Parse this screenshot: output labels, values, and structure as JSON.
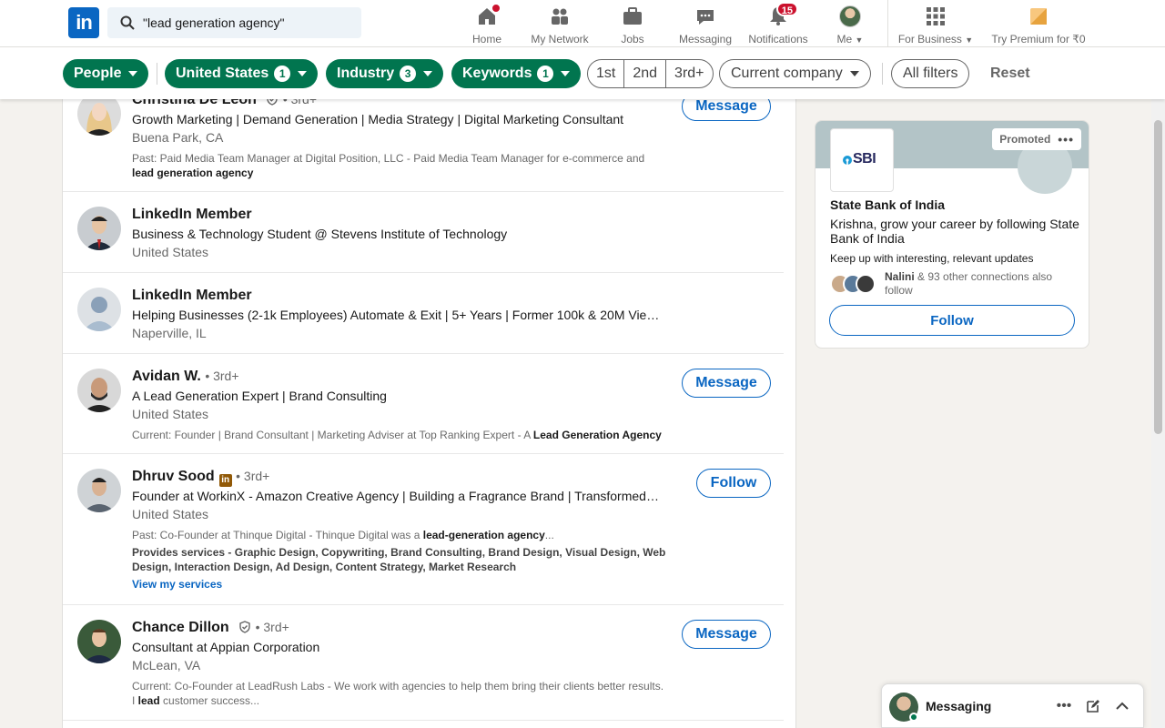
{
  "nav": {
    "logo": "in",
    "search_value": "\"lead generation agency\"",
    "items": [
      {
        "label": "Home"
      },
      {
        "label": "My Network"
      },
      {
        "label": "Jobs"
      },
      {
        "label": "Messaging"
      },
      {
        "label": "Notifications",
        "badge": "15"
      },
      {
        "label": "Me"
      },
      {
        "label": "For Business"
      },
      {
        "label": "Try Premium for ₹0"
      }
    ]
  },
  "filters": {
    "people": "People",
    "location": "United States",
    "location_count": "1",
    "industry": "Industry",
    "industry_count": "3",
    "keywords": "Keywords",
    "keywords_count": "1",
    "degrees": [
      "1st",
      "2nd",
      "3rd+"
    ],
    "current_company": "Current company",
    "all_filters": "All filters",
    "reset": "Reset"
  },
  "results": [
    {
      "name": "Christina De Leon",
      "degree": "• 3rd+",
      "headline": "Growth Marketing | Demand Generation | Media Strategy | Digital Marketing Consultant",
      "location": "Buena Park, CA",
      "summary_prefix": "Past: Paid Media Team Manager at Digital Position, LLC - Paid Media Team Manager for e-commerce and ",
      "summary_bold": "lead generation agency",
      "action": "Message"
    },
    {
      "name": "LinkedIn Member",
      "headline": "Business & Technology Student @ Stevens Institute of Technology",
      "location": "United States"
    },
    {
      "name": "LinkedIn Member",
      "headline": "Helping Businesses (2-1k Employees) Automate & Exit | 5+ Years | Former 100k & 20M View…",
      "location": "Naperville, IL"
    },
    {
      "name": "Avidan W.",
      "degree": "• 3rd+",
      "headline": "A Lead Generation Expert | Brand Consulting",
      "location": "United States",
      "summary_prefix": "Current: Founder | Brand Consultant | Marketing Adviser at Top Ranking Expert - A ",
      "summary_bold": "Lead Generation Agency",
      "action": "Message"
    },
    {
      "name": "Dhruv Sood",
      "degree": "• 3rd+",
      "headline": "Founder at WorkinX - Amazon Creative Agency | Building a Fragrance Brand | Transformed…",
      "location": "United States",
      "summary_prefix": "Past: Co-Founder at Thinque Digital - Thinque Digital was a ",
      "summary_bold": "lead-generation agency",
      "summary_suffix": "...",
      "services": "Provides services - Graphic Design, Copywriting, Brand Consulting, Brand Design, Visual Design, Web Design, Interaction Design, Ad Design, Content Strategy, Market Research",
      "services_link": "View my services",
      "action": "Follow"
    },
    {
      "name": "Chance Dillon",
      "degree": "• 3rd+",
      "headline": "Consultant at Appian Corporation",
      "location": "McLean, VA",
      "summary_prefix": "Current: Co-Founder at LeadRush Labs - We work with agencies to help them bring their clients better results. I ",
      "summary_bold": "lead",
      "summary_suffix": " customer success...",
      "action": "Message"
    }
  ],
  "ad": {
    "promoted": "Promoted",
    "logo_text": "SBI",
    "company": "State Bank of India",
    "pitch": "Krishna, grow your career by following State Bank of India",
    "sub": "Keep up with interesting, relevant updates",
    "conn_name": "Nalini",
    "conn_rest": " & 93 other connections also follow",
    "follow": "Follow"
  },
  "messaging": {
    "title": "Messaging"
  },
  "colors": {
    "brand": "#0a66c2",
    "filter_active": "#01754f",
    "badge": "#cb112d"
  }
}
